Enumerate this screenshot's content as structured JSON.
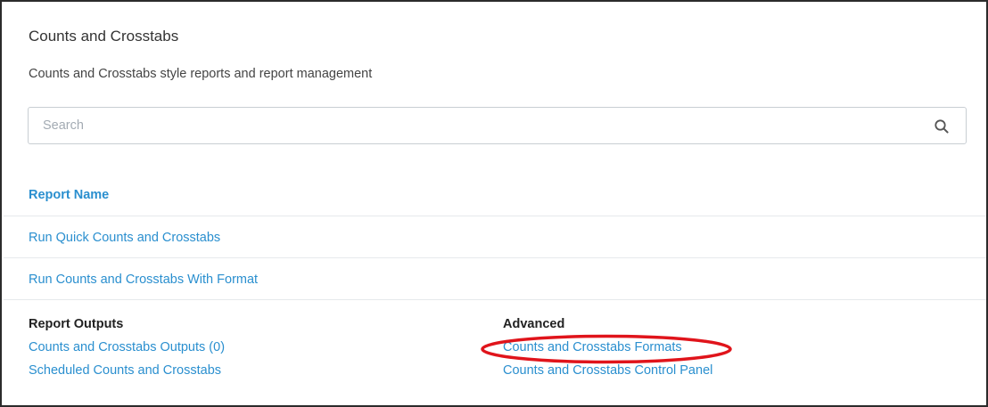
{
  "page": {
    "title": "Counts and Crosstabs",
    "subtitle": "Counts and Crosstabs style reports and report management"
  },
  "search": {
    "placeholder": "Search",
    "value": ""
  },
  "table": {
    "column_header": "Report Name",
    "rows": [
      "Run Quick Counts and Crosstabs",
      "Run Counts and Crosstabs With Format"
    ]
  },
  "report_outputs": {
    "heading": "Report Outputs",
    "links": [
      "Counts and Crosstabs Outputs (0)",
      "Scheduled Counts and Crosstabs"
    ]
  },
  "advanced": {
    "heading": "Advanced",
    "links": [
      "Counts and Crosstabs Formats",
      "Counts and Crosstabs Control Panel"
    ]
  },
  "colors": {
    "link": "#2a8fcf",
    "highlight": "#e0141b"
  },
  "icons": {
    "search": "search-icon"
  }
}
